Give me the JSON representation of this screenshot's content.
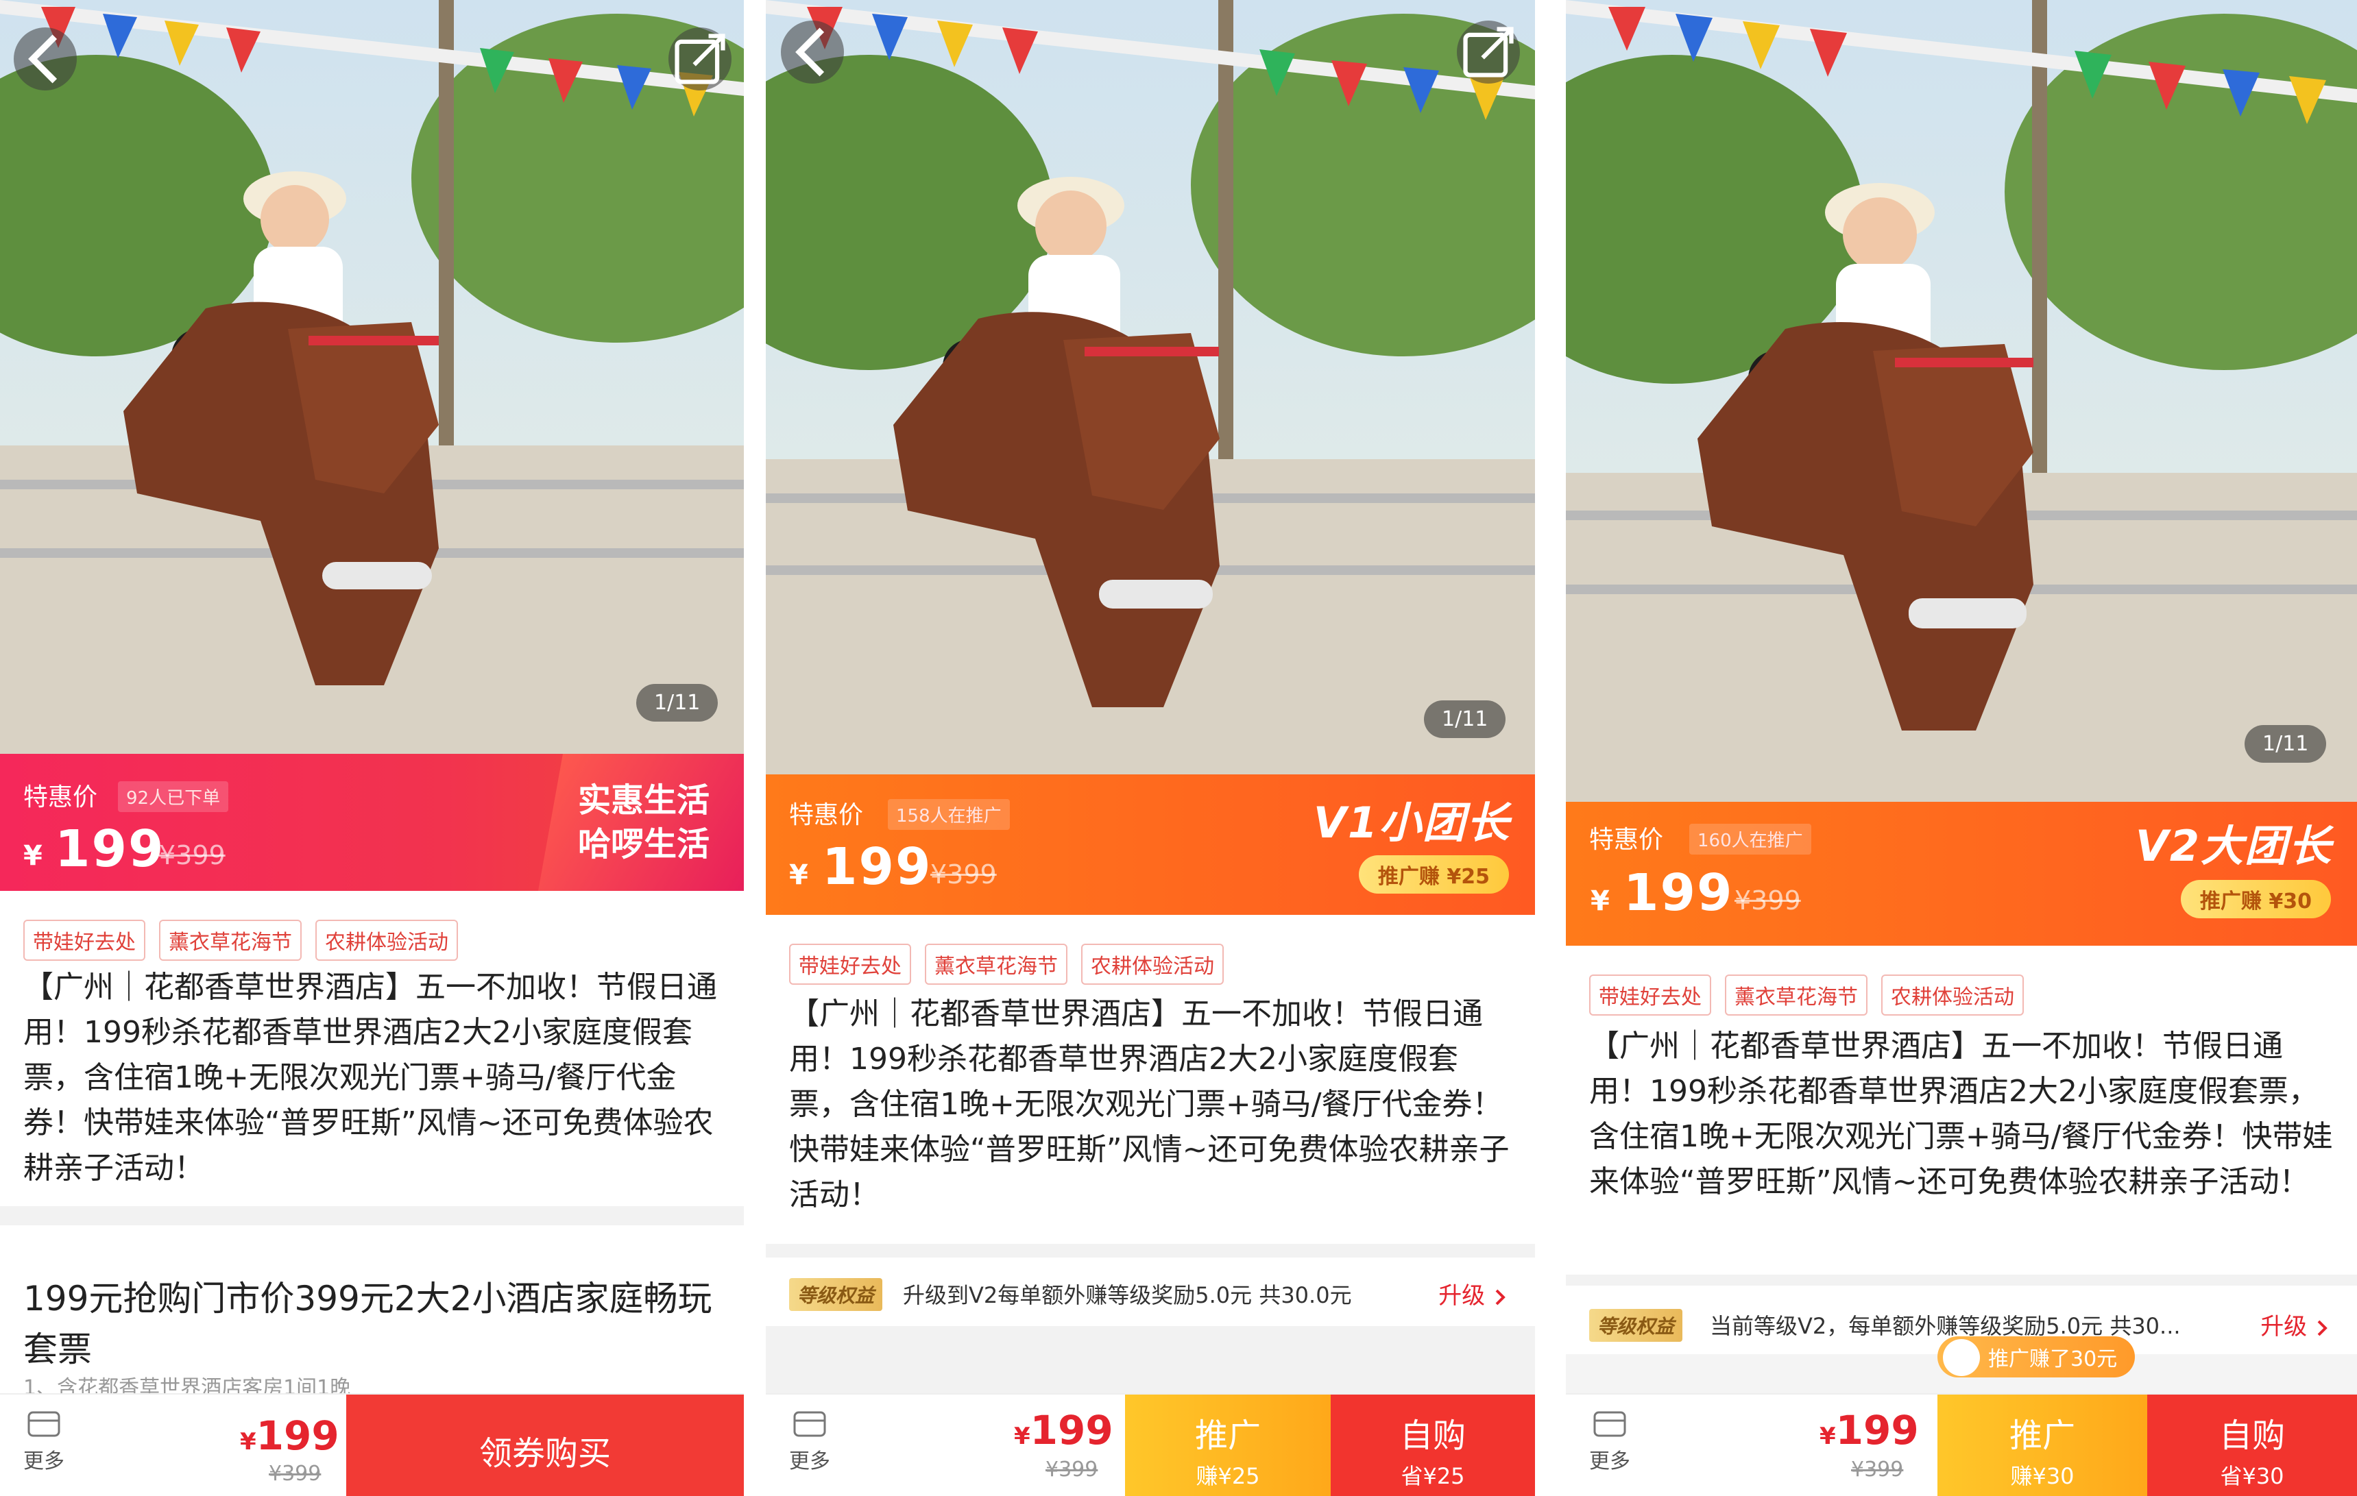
{
  "panel1": {
    "counter": "1/11",
    "special_label": "特惠价",
    "sold": "92人已下单",
    "yen": "¥",
    "price": "199",
    "orig": "¥399",
    "brand_line1": "实惠生活",
    "brand_line2": "哈啰生活",
    "tags": [
      "带娃好去处",
      "薰衣草花海节",
      "农耕体验活动"
    ],
    "description": "【广州｜花都香草世界酒店】五一不加收！节假日通用！199秒杀花都香草世界酒店2大2小家庭度假套票，含住宿1晚+无限次观光门票+骑马/餐厅代金券！快带娃来体验“普罗旺斯”风情~还可免费体验农耕亲子活动！",
    "detail_title": "199元抢购门市价399元2大2小酒店家庭畅玩套票",
    "detail_sub": "1、含花都香草世界酒店客房1间1晚",
    "more": "更多",
    "bottom_price_symbol": "¥",
    "bottom_price": "199",
    "bottom_orig": "¥399",
    "buy_button": "领券购买",
    "colors": {
      "accent": "#f5285a",
      "brand": "#e81f5a"
    }
  },
  "panel2": {
    "counter": "1/11",
    "special_label": "特惠价",
    "promoting": "158人在推广",
    "yen": "¥",
    "price": "199",
    "orig": "¥399",
    "level_title": "V1小团长",
    "earn": "推广赚 ¥25",
    "tags": [
      "带娃好去处",
      "薰衣草花海节",
      "农耕体验活动"
    ],
    "description": "【广州｜花都香草世界酒店】五一不加收！节假日通用！199秒杀花都香草世界酒店2大2小家庭度假套票，含住宿1晚+无限次观光门票+骑马/餐厅代金券！快带娃来体验“普罗旺斯”风情~还可免费体验农耕亲子活动！",
    "rights_badge": "等级权益",
    "rights_text": "升级到V2每单额外赚等级奖励5.0元 共30.0元",
    "rights_action": "升级",
    "more": "更多",
    "bottom_price_symbol": "¥",
    "bottom_price": "199",
    "bottom_orig": "¥399",
    "promote_label": "推广",
    "promote_sub": "赚¥25",
    "selfbuy_label": "自购",
    "selfbuy_sub": "省¥25",
    "colors": {
      "accent": "#ff6a1e",
      "promote": "#ffb81c",
      "selfbuy": "#f2342e"
    }
  },
  "panel3": {
    "counter": "1/11",
    "special_label": "特惠价",
    "promoting": "160人在推广",
    "yen": "¥",
    "price": "199",
    "orig": "¥399",
    "level_title": "V2大团长",
    "earn": "推广赚 ¥30",
    "tags": [
      "带娃好去处",
      "薰衣草花海节",
      "农耕体验活动"
    ],
    "description": "【广州｜花都香草世界酒店】五一不加收！节假日通用！199秒杀花都香草世界酒店2大2小家庭度假套票，含住宿1晚+无限次观光门票+骑马/餐厅代金券！快带娃来体验“普罗旺斯”风情~还可免费体验农耕亲子活动！",
    "rights_badge": "等级权益",
    "rights_text": "当前等级V2，每单额外赚等级奖励5.0元 共30...",
    "rights_action": "升级",
    "toast": "推广赚了30元",
    "more": "更多",
    "bottom_price_symbol": "¥",
    "bottom_price": "199",
    "bottom_orig": "¥399",
    "promote_label": "推广",
    "promote_sub": "赚¥30",
    "selfbuy_label": "自购",
    "selfbuy_sub": "省¥30",
    "colors": {
      "accent": "#ff6a1e",
      "promote": "#ffb81c",
      "selfbuy": "#f2342e"
    }
  }
}
